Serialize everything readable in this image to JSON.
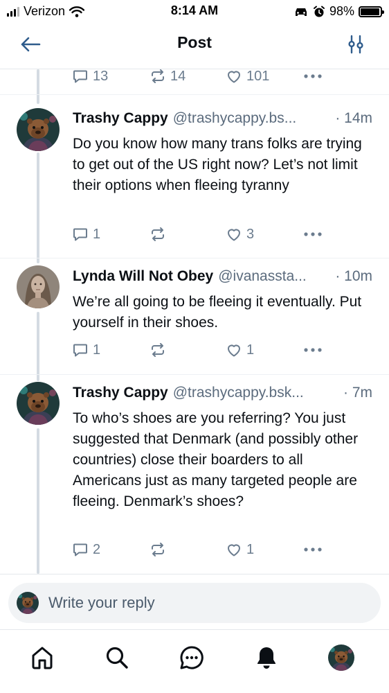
{
  "status_bar": {
    "carrier": "Verizon",
    "time": "8:14 AM",
    "battery": "98%",
    "battery_level": 0.98
  },
  "header": {
    "title": "Post",
    "back_icon": "arrow-left-icon",
    "filter_icon": "sliders-icon"
  },
  "previous_post_actions": {
    "replies": "13",
    "reposts": "14",
    "likes": "101"
  },
  "posts": [
    {
      "display_name": "Trashy Cappy",
      "handle": "@trashycappy.bs...",
      "time": "· 14m",
      "text": "Do you know how many trans folks are trying to get out of the US right now? Let’s not limit their options when fleeing tyranny",
      "replies": "1",
      "reposts": "",
      "likes": "3",
      "avatar": "capybara-avatar"
    },
    {
      "display_name": "Lynda Will Not Obey",
      "handle": "@ivanassta...",
      "time": "· 10m",
      "text": "We’re all going to be fleeing it eventually. Put yourself in their shoes.",
      "replies": "1",
      "reposts": "",
      "likes": "1",
      "avatar": "woman-portrait-avatar"
    },
    {
      "display_name": "Trashy Cappy",
      "handle": "@trashycappy.bsk...",
      "time": "· 7m",
      "text": "To who’s shoes are you referring? You just suggested that Denmark (and possibly other countries) close their boarders to all Americans just as many targeted people are fleeing. Denmark’s shoes?",
      "replies": "2",
      "reposts": "",
      "likes": "1",
      "avatar": "capybara-avatar"
    }
  ],
  "composer": {
    "placeholder": "Write your reply"
  },
  "tabbar": {
    "items": [
      "home-icon",
      "search-icon",
      "chat-icon",
      "bell-icon",
      "profile-avatar"
    ],
    "active": "bell-icon"
  },
  "colors": {
    "text": "#0b0f14",
    "muted": "#5b6b7d",
    "action": "#6b7c8e",
    "accent": "#1c6ee8",
    "thread_line": "#d4dbe2",
    "composer_bg": "#f1f3f5"
  }
}
